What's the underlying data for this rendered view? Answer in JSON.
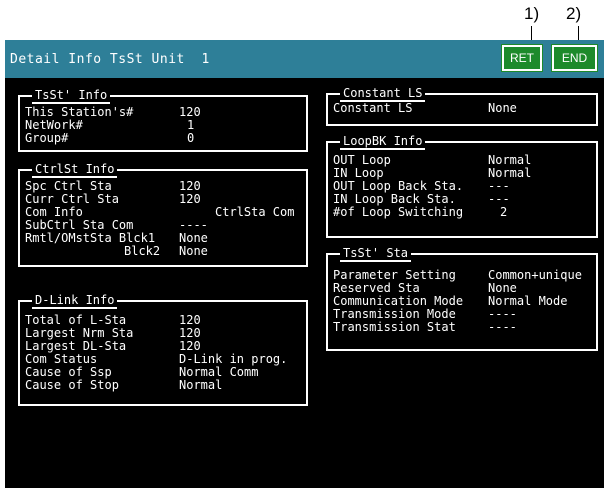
{
  "callouts": {
    "ret": "1)",
    "end": "2)"
  },
  "titlebar": {
    "title": "Detail Info TsSt Unit  1"
  },
  "buttons": {
    "ret": "RET",
    "end": "END"
  },
  "tsst_info": {
    "title": "TsSt' Info",
    "rows": [
      {
        "label": "This Station's#",
        "value": "120"
      },
      {
        "label": "NetWork#",
        "value": "1"
      },
      {
        "label": "Group#",
        "value": "0"
      }
    ]
  },
  "ctrlst_info": {
    "title": "CtrlSt Info",
    "rows": [
      {
        "label": "Spc Ctrl Sta",
        "value": "120"
      },
      {
        "label": "Curr Ctrl Sta",
        "value": "120"
      },
      {
        "label": "Com Info",
        "value": "CtrlSta Com"
      },
      {
        "label": "SubCtrl Sta Com",
        "value": "----"
      },
      {
        "label": "Rmtl/OMstSta Blck1",
        "value": "None"
      },
      {
        "label": "Blck2",
        "value": "None"
      }
    ]
  },
  "dlink_info": {
    "title": "D-Link Info",
    "rows": [
      {
        "label": "Total of L-Sta",
        "value": "120"
      },
      {
        "label": "Largest Nrm Sta",
        "value": "120"
      },
      {
        "label": "Largest DL-Sta",
        "value": "120"
      },
      {
        "label": "Com Status",
        "value": "D-Link in prog."
      },
      {
        "label": "Cause of Ssp",
        "value": "Normal Comm"
      },
      {
        "label": "Cause of Stop",
        "value": "Normal"
      }
    ]
  },
  "constant_ls": {
    "title": "Constant LS",
    "rows": [
      {
        "label": "Constant LS",
        "value": "None"
      }
    ]
  },
  "loopbk_info": {
    "title": "LoopBK Info",
    "rows": [
      {
        "label": "OUT Loop",
        "value": "Normal"
      },
      {
        "label": "IN Loop",
        "value": "Normal"
      },
      {
        "label": "OUT Loop Back Sta.",
        "value": "---"
      },
      {
        "label": "IN Loop Back Sta.",
        "value": "---"
      },
      {
        "label": "#of Loop Switching",
        "value": "2"
      }
    ]
  },
  "tsst_sta": {
    "title": "TsSt' Sta",
    "rows": [
      {
        "label": "Parameter Setting",
        "value": "Common+unique"
      },
      {
        "label": "Reserved Sta",
        "value": "None"
      },
      {
        "label": "Communication Mode",
        "value": "Normal Mode"
      },
      {
        "label": "Transmission Mode",
        "value": "----"
      },
      {
        "label": "Transmission Stat",
        "value": "----"
      }
    ]
  },
  "colors": {
    "titlebar": "#2e7f98",
    "button": "#1d8a2b",
    "screen": "#000000",
    "text": "#ffffff"
  }
}
